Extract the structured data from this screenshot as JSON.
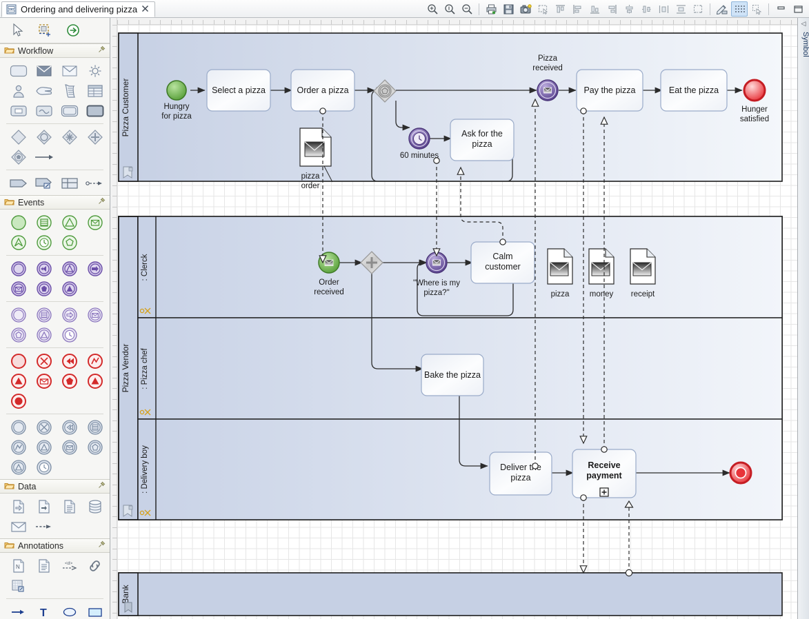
{
  "window": {
    "tab_title": "Ordering and delivering pizza",
    "tab_icon": "diagram-icon",
    "tab_close": "✖"
  },
  "toolbar": {
    "buttons": [
      {
        "name": "zoom-in-icon",
        "tooltip": "Zoom In"
      },
      {
        "name": "zoom-actual-icon",
        "tooltip": "Actual Size"
      },
      {
        "name": "zoom-out-icon",
        "tooltip": "Zoom Out"
      },
      {
        "name": "print-icon",
        "tooltip": "Print"
      },
      {
        "name": "save-icon",
        "tooltip": "Save"
      },
      {
        "name": "camera-icon",
        "tooltip": "Export Image"
      },
      {
        "name": "select-region-icon",
        "tooltip": "Select Region"
      },
      {
        "name": "align-top-icon",
        "tooltip": "Align Top"
      },
      {
        "name": "align-left-icon",
        "tooltip": "Align Left"
      },
      {
        "name": "align-bottom-icon",
        "tooltip": "Align Bottom"
      },
      {
        "name": "align-right-icon",
        "tooltip": "Align Right"
      },
      {
        "name": "align-center-h-icon",
        "tooltip": "Align Center Horizontal"
      },
      {
        "name": "align-center-v-icon",
        "tooltip": "Align Center Vertical"
      },
      {
        "name": "distribute-h-icon",
        "tooltip": "Distribute Horizontally"
      },
      {
        "name": "distribute-v-icon",
        "tooltip": "Distribute Vertically"
      },
      {
        "name": "match-size-icon",
        "tooltip": "Match Size"
      },
      {
        "name": "pencil-icon",
        "tooltip": "Edit Style"
      },
      {
        "name": "grid-icon",
        "tooltip": "Toggle Grid",
        "selected": true
      },
      {
        "name": "snap-icon",
        "tooltip": "Snap To Grid"
      },
      {
        "name": "minimize-icon",
        "tooltip": "Minimize"
      },
      {
        "name": "maximize-icon",
        "tooltip": "Maximize"
      }
    ]
  },
  "palette": {
    "tools": [
      {
        "name": "pointer-tool",
        "label": "Select"
      },
      {
        "name": "marquee-tool",
        "label": "Marquee"
      },
      {
        "name": "connection-tool",
        "label": "Connection"
      }
    ],
    "sections": [
      {
        "title": "Workflow",
        "folder_icon": "folder-icon",
        "pin_icon": "pin-icon",
        "groups": [
          [
            "task-icon",
            "send-task-icon",
            "receive-task-icon",
            "service-task-icon"
          ],
          [
            "user-task-icon",
            "manual-task-icon",
            "script-task-icon",
            "business-rule-task-icon"
          ],
          [
            "subprocess-collapsed-icon",
            "event-subprocess-icon",
            "transaction-icon",
            "call-activity-icon"
          ],
          [
            "exclusive-gateway-icon",
            "inclusive-gateway-icon",
            "complex-gateway-icon",
            "parallel-gateway-icon"
          ],
          [
            "event-gateway-icon",
            "sequence-flow-icon"
          ],
          [
            "pool-icon",
            "lane-icon",
            "grouping-icon",
            "association-icon"
          ]
        ]
      },
      {
        "title": "Events",
        "folder_icon": "folder-icon",
        "pin_icon": "pin-icon",
        "groups": [
          [
            "start-none-icon",
            "start-multiple-icon",
            "start-signal-icon",
            "start-message-icon"
          ],
          [
            "start-escalation-icon",
            "start-timer-icon",
            "start-conditional-icon"
          ],
          [
            "intermediate-none-icon",
            "intermediate-link-catch-icon",
            "intermediate-signal-icon",
            "intermediate-link-throw-icon"
          ],
          [
            "intermediate-message-icon",
            "intermediate-escalation-icon",
            "intermediate-signal-throw-icon"
          ],
          [
            "catch-none-icon",
            "catch-multiple-icon",
            "catch-link-icon",
            "catch-message-icon"
          ],
          [
            "catch-escalation-icon",
            "catch-signal-icon",
            "catch-timer-icon"
          ],
          [
            "end-none-icon",
            "end-cancel-icon",
            "end-compensate-icon",
            "end-error-icon"
          ],
          [
            "end-signal-icon",
            "end-message-icon",
            "end-escalation-icon",
            "end-multiple-icon"
          ],
          [
            "end-terminate-icon"
          ],
          [
            "boundary-none-icon",
            "boundary-cancel-icon",
            "boundary-compensate-icon",
            "boundary-multiple-icon"
          ],
          [
            "boundary-error-icon",
            "boundary-signal-icon",
            "boundary-message-icon",
            "boundary-escalation-icon"
          ],
          [
            "boundary-conditional-icon",
            "boundary-timer-icon"
          ]
        ]
      },
      {
        "title": "Data",
        "folder_icon": "folder-icon",
        "pin_icon": "pin-icon",
        "groups": [
          [
            "data-input-icon",
            "data-output-icon",
            "data-object-icon",
            "data-store-icon"
          ],
          [
            "message-icon",
            "message-flow-icon"
          ]
        ]
      },
      {
        "title": "Annotations",
        "folder_icon": "folder-icon",
        "pin_icon": "pin-icon",
        "groups": [
          [
            "note-icon",
            "text-annotation-icon",
            "directed-association-icon",
            "link-icon"
          ],
          [
            "table-annotation-icon"
          ],
          [
            "arrow-shape-icon",
            "text-shape-icon",
            "ellipse-shape-icon",
            "rectangle-shape-icon"
          ]
        ]
      }
    ]
  },
  "symbol_panel": {
    "label": "Symbol",
    "collapse_icon": "collapse-left-icon"
  },
  "diagram": {
    "pools": [
      {
        "name": "Pizza Customer",
        "lanes": []
      },
      {
        "name": "Pizza Vendor",
        "lanes": [
          ": Clerck",
          ": Pizza chef",
          ": Delivery boy"
        ]
      },
      {
        "name": "Bank",
        "lanes": []
      }
    ],
    "nodes": [
      {
        "id": "hungry",
        "type": "start-event",
        "label": "Hungry\nfor pizza",
        "lane": "Pizza Customer"
      },
      {
        "id": "select_pizza",
        "type": "task",
        "label": "Select a pizza",
        "lane": "Pizza Customer"
      },
      {
        "id": "order_pizza",
        "type": "task",
        "label": "Order a pizza",
        "lane": "Pizza Customer"
      },
      {
        "id": "event_gw",
        "type": "event-based-gateway",
        "label": "",
        "lane": "Pizza Customer"
      },
      {
        "id": "timer60",
        "type": "timer-intermediate",
        "label": "60 minutes",
        "lane": "Pizza Customer"
      },
      {
        "id": "ask_pizza",
        "type": "task",
        "label": "Ask for the\npizza",
        "lane": "Pizza Customer"
      },
      {
        "id": "pizza_recv",
        "type": "message-intermediate",
        "label": "Pizza\nreceived",
        "lane": "Pizza Customer"
      },
      {
        "id": "pay_pizza",
        "type": "task",
        "label": "Pay the pizza",
        "lane": "Pizza Customer"
      },
      {
        "id": "eat_pizza",
        "type": "task",
        "label": "Eat the pizza",
        "lane": "Pizza Customer"
      },
      {
        "id": "hunger_sat",
        "type": "end-event",
        "label": "Hunger\nsatisfied",
        "lane": "Pizza Customer"
      },
      {
        "id": "pizza_order_do",
        "type": "data-object-message",
        "label": "pizza\norder",
        "lane": "Pizza Customer"
      },
      {
        "id": "order_recv",
        "type": "message-start-event",
        "label": "Order\nreceived",
        "lane": ": Clerck"
      },
      {
        "id": "parallel_gw",
        "type": "parallel-gateway",
        "label": "",
        "lane": ": Clerck"
      },
      {
        "id": "where_pizza",
        "type": "message-intermediate",
        "label": "\"Where is my\npizza?\"",
        "lane": ": Clerck"
      },
      {
        "id": "calm_cust",
        "type": "task",
        "label": "Calm\ncustomer",
        "lane": ": Clerck"
      },
      {
        "id": "do_pizza",
        "type": "data-object-message",
        "label": "pizza",
        "lane": ": Clerck"
      },
      {
        "id": "do_money",
        "type": "data-object-message",
        "label": "money",
        "lane": ": Clerck"
      },
      {
        "id": "do_receipt",
        "type": "data-object-message",
        "label": "receipt",
        "lane": ": Clerck"
      },
      {
        "id": "bake_pizza",
        "type": "task",
        "label": "Bake the pizza",
        "lane": ": Pizza chef"
      },
      {
        "id": "deliver_pizza",
        "type": "task",
        "label": "Deliver the\npizza",
        "lane": ": Delivery boy"
      },
      {
        "id": "recv_payment",
        "type": "collapsed-subprocess",
        "label": "Receive\npayment",
        "lane": ": Delivery boy",
        "marker": "+"
      },
      {
        "id": "vendor_end",
        "type": "terminate-end-event",
        "label": "",
        "lane": ": Delivery boy"
      }
    ],
    "data_objects": [
      "pizza order",
      "pizza",
      "money",
      "receipt"
    ],
    "colors": {
      "pool_fill": "#c6d0e4",
      "lane_fill_a": "#c8d2e6",
      "lane_fill_b": "#eef2f8",
      "task_stroke": "#9aabc9",
      "start_event": "#5fa83c",
      "end_event": "#e8343a",
      "intermediate_event": "#6b4fa8",
      "gateway": "#9a9a9a",
      "grid": "#e6e6e6",
      "accent": "#cfe3f7"
    }
  }
}
